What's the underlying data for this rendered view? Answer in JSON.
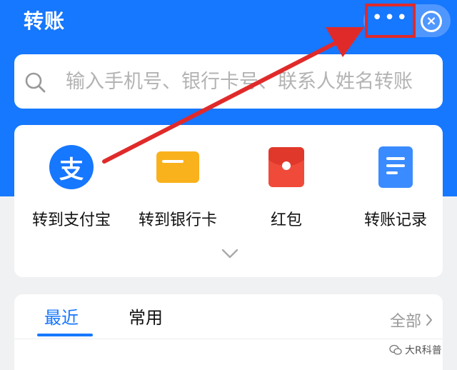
{
  "header": {
    "title": "转账",
    "more_label": "•••",
    "close_label": "×"
  },
  "search": {
    "placeholder": "输入手机号、银行卡号、联系人姓名转账"
  },
  "actions": [
    {
      "label": "转到支付宝",
      "icon": "alipay-icon",
      "glyph": "支"
    },
    {
      "label": "转到银行卡",
      "icon": "bank-card-icon"
    },
    {
      "label": "红包",
      "icon": "red-packet-icon"
    },
    {
      "label": "转账记录",
      "icon": "transfer-record-icon"
    }
  ],
  "tabs": {
    "recent": "最近",
    "common": "常用",
    "all": "全部"
  },
  "watermark": {
    "text": "大R科普"
  },
  "colors": {
    "brand_blue": "#1677ff",
    "highlight_red": "#e02a2a",
    "card_yellow": "#f9b21c",
    "packet_red": "#f04a3a"
  }
}
